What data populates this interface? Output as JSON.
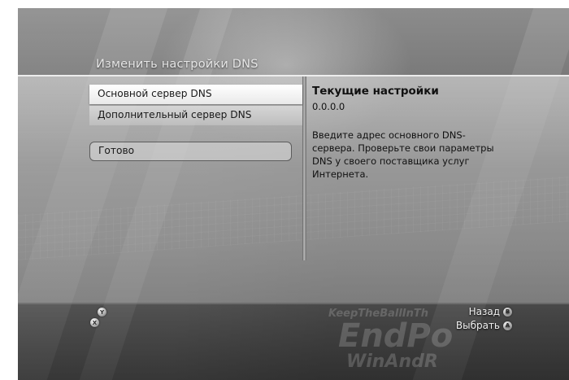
{
  "dialog": {
    "title": "Изменить настройки DNS"
  },
  "menu": {
    "items": [
      {
        "label": "Основной сервер DNS",
        "selected": true
      },
      {
        "label": "Дополнительный сервер DNS",
        "selected": false
      }
    ],
    "done_label": "Готово"
  },
  "info": {
    "current_label": "Текущие настройки",
    "current_value": "0.0.0.0",
    "help_text": "Введите адрес основного DNS-сервера. Проверьте свои параметры DNS у своего поставщика услуг Интернета."
  },
  "footer": {
    "back_label": "Назад",
    "select_label": "Выбрать",
    "buttons": {
      "y": "Y",
      "x": "X",
      "b": "B",
      "a": "A"
    }
  },
  "background_text": [
    "KeepTheBallInTh",
    "EndPo",
    "WinAndR"
  ]
}
